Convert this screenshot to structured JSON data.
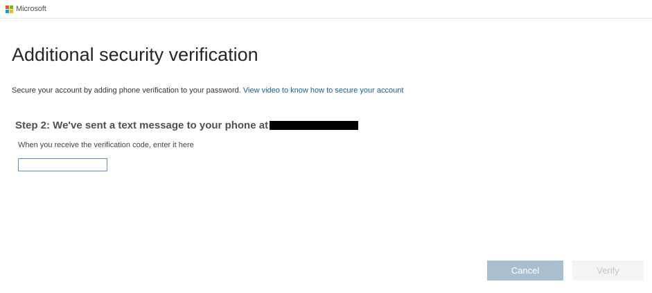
{
  "header": {
    "brand": "Microsoft",
    "logo_colors": [
      "#f25022",
      "#7fba00",
      "#00a4ef",
      "#ffb900"
    ]
  },
  "main": {
    "title": "Additional security verification",
    "intro_text": "Secure your account by adding phone verification to your password.",
    "intro_link": "View video to know how to secure your account",
    "step_heading": "Step 2: We've sent a text message to your phone at",
    "code_label": "When you receive the verification code, enter it here",
    "code_value": ""
  },
  "footer": {
    "cancel_label": "Cancel",
    "verify_label": "Verify"
  },
  "colors": {
    "link": "#1a5c8e",
    "cancel_bg": "#a9bfcf",
    "verify_bg": "#f5f3f6",
    "input_border": "#5a8bd0"
  }
}
